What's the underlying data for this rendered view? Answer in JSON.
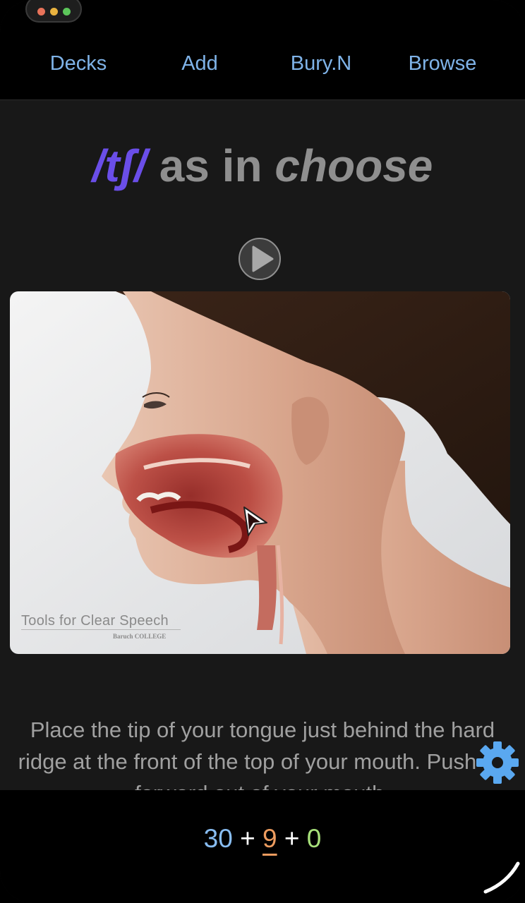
{
  "nav": {
    "items": [
      {
        "label": "Decks"
      },
      {
        "label": "Add"
      },
      {
        "label": "Bury.N"
      },
      {
        "label": "Browse"
      }
    ]
  },
  "card": {
    "ipa": "/tʃ/",
    "middle": " as in ",
    "word": "choose",
    "media": {
      "watermark_line1": "Tools for Clear Speech",
      "watermark_line2": "Baruch COLLEGE"
    },
    "instructions": "Place the tip of your tongue just behind the hard ridge at the front of the top of your mouth. Push air forward out of your mouth."
  },
  "counts": {
    "new": "30",
    "plus1": "+",
    "learning": "9",
    "plus2": "+",
    "review": "0"
  },
  "icons": {
    "play": "play-icon",
    "settings": "gear-icon",
    "cursor": "cursor-icon"
  },
  "colors": {
    "accent_link": "#7fb3e8",
    "ipa": "#6a4ee8",
    "new_count": "#88bdf2",
    "learning_count": "#ed9c5f",
    "review_count": "#a7e07a",
    "gear": "#5aa8f0"
  }
}
